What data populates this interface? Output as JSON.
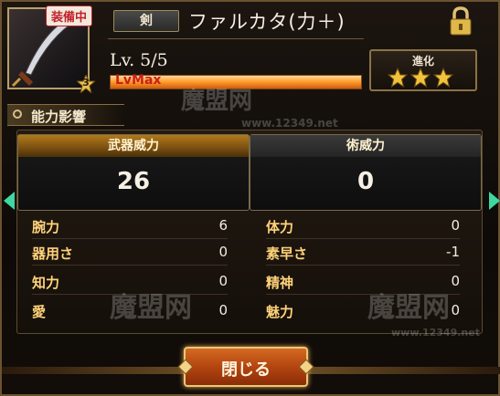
{
  "header": {
    "equip_badge": "装備中",
    "rarity": "3",
    "type_tag": "剣",
    "item_name": "ファルカタ(力＋)",
    "level_text": "Lv. 5/5",
    "level_progress": 1.0,
    "lvmax_label": "LvMax",
    "evolution_label": "進化",
    "evolution_stars": 3,
    "icons": [
      "lock-icon",
      "weapon-icon",
      "star-icon"
    ]
  },
  "section": {
    "title": "能力影響"
  },
  "power": {
    "weapon_label": "武器威力",
    "weapon_value": "26",
    "art_label": "術威力",
    "art_value": "0"
  },
  "stats_left": [
    {
      "label": "腕力",
      "value": "6"
    },
    {
      "label": "器用さ",
      "value": "0"
    },
    {
      "label": "知力",
      "value": "0"
    },
    {
      "label": "愛",
      "value": "0"
    }
  ],
  "stats_right": [
    {
      "label": "体力",
      "value": "0"
    },
    {
      "label": "素早さ",
      "value": "-1"
    },
    {
      "label": "精神",
      "value": "0"
    },
    {
      "label": "魅力",
      "value": "0"
    }
  ],
  "close_label": "閉じる",
  "watermark": {
    "brand": "魔盟网",
    "url": "www.12349.net"
  },
  "colors": {
    "accent_gold": "#ffd27a",
    "button_orange": "#b34510",
    "level_bar": "#ff9a28"
  }
}
